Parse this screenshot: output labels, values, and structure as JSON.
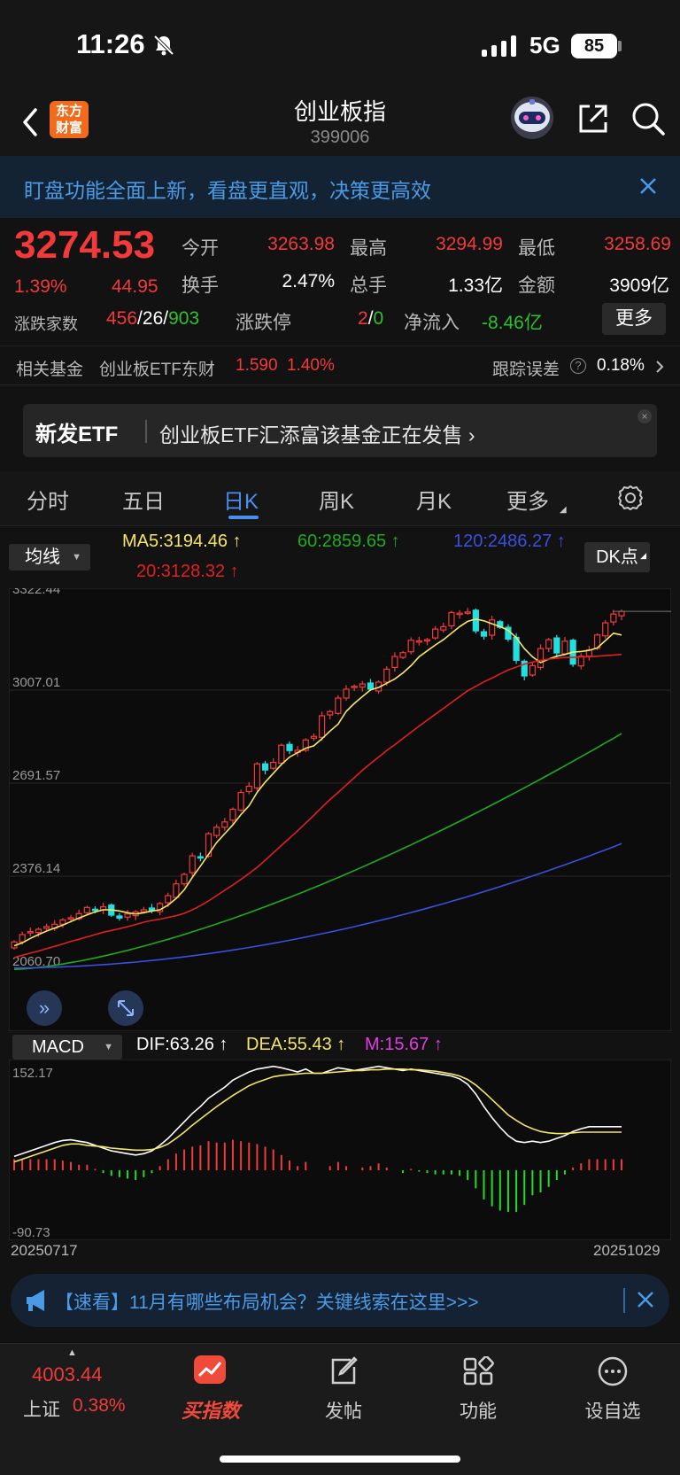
{
  "status_bar": {
    "time": "11:26",
    "network": "5G",
    "battery": "85"
  },
  "header": {
    "title": "创业板指",
    "code": "399006",
    "logo_line1": "东方",
    "logo_line2": "财富"
  },
  "banner": {
    "text": "盯盘功能全面上新，看盘更直观，决策更高效"
  },
  "quote": {
    "price": "3274.53",
    "change_pct": "1.39%",
    "change": "44.95",
    "open_label": "今开",
    "open": "3263.98",
    "high_label": "最高",
    "high": "3294.99",
    "low_label": "最低",
    "low": "3258.69",
    "turnover_label": "换手",
    "turnover": "2.47%",
    "volume_label": "总手",
    "volume": "1.33亿",
    "amount_label": "金额",
    "amount": "3909亿",
    "breadth_label": "涨跌家数",
    "up_count": "456",
    "flat_count": "26",
    "down_count": "903",
    "slash": "/",
    "limit_label": "涨跌停",
    "limit_up": "2",
    "limit_down": "0",
    "netflow_label": "净流入",
    "netflow": "-8.46亿",
    "more": "更多"
  },
  "related_fund": {
    "label": "相关基金",
    "name": "创业板ETF东财",
    "price": "1.590",
    "pct": "1.40%",
    "tracking_label": "跟踪误差",
    "tracking_value": "0.18%",
    "help": "?"
  },
  "new_etf": {
    "tag": "新发ETF",
    "text": "创业板ETF汇添富该基金正在发售 ›",
    "close": "×"
  },
  "tabs": [
    "分时",
    "五日",
    "日K",
    "周K",
    "月K",
    "更多"
  ],
  "ma_row": {
    "button": "均线",
    "ma5": "MA5:3194.46 ↑",
    "ma20": "20:3128.32 ↑",
    "ma60": "60:2859.65 ↑",
    "ma120": "120:2486.27 ↑",
    "dk": "DK点"
  },
  "macd_row": {
    "button": "MACD",
    "dif": "DIF:63.26 ↑",
    "dea": "DEA:55.43 ↑",
    "m": "M:15.67 ↑"
  },
  "colors": {
    "up": "#f23a3a",
    "down": "#22e0e0",
    "ma5": "#f5e663",
    "ma20": "#e02020",
    "ma60": "#1faa1f",
    "ma120": "#3b4fe0",
    "accent": "#4a8ef0"
  },
  "chart_data": [
    {
      "type": "candlestick",
      "title": "",
      "y_ticks": [
        "3322.44",
        "3007.01",
        "2691.57",
        "2376.14",
        "2060.70"
      ],
      "ylim": [
        2060.7,
        3322.44
      ],
      "x_start": "20250717",
      "x_end": "20251029",
      "close": [
        2153,
        2178,
        2188,
        2196,
        2205,
        2213,
        2228,
        2235,
        2249,
        2270,
        2262,
        2272,
        2244,
        2234,
        2248,
        2255,
        2262,
        2259,
        2283,
        2310,
        2350,
        2382,
        2445,
        2441,
        2520,
        2542,
        2560,
        2603,
        2660,
        2681,
        2757,
        2736,
        2762,
        2820,
        2802,
        2803,
        2838,
        2850,
        2920,
        2934,
        2980,
        3010,
        3020,
        3028,
        3010,
        3034,
        3078,
        3121,
        3134,
        3176,
        3174,
        3178,
        3214,
        3222,
        3270,
        3268,
        3272,
        3208,
        3190,
        3245,
        3220,
        3180,
        3108,
        3055,
        3090,
        3148,
        3178,
        3133,
        3173,
        3095,
        3122,
        3143,
        3194,
        3235,
        3265,
        3274
      ],
      "series": [
        {
          "name": "MA5",
          "values": [
            2140,
            2150,
            2165,
            2178,
            2190,
            2200,
            2210,
            2222,
            2234,
            2245,
            2255,
            2262,
            2262,
            2258,
            2252,
            2248,
            2252,
            2258,
            2262,
            2278,
            2300,
            2330,
            2372,
            2410,
            2450,
            2490,
            2520,
            2550,
            2585,
            2615,
            2660,
            2695,
            2725,
            2755,
            2780,
            2795,
            2810,
            2818,
            2842,
            2868,
            2892,
            2935,
            2962,
            2985,
            3008,
            3016,
            3030,
            3045,
            3065,
            3090,
            3120,
            3140,
            3160,
            3178,
            3200,
            3222,
            3240,
            3248,
            3242,
            3232,
            3222,
            3210,
            3185,
            3148,
            3120,
            3100,
            3112,
            3122,
            3128,
            3136,
            3138,
            3142,
            3150,
            3175,
            3200,
            3194
          ]
        },
        {
          "name": "20",
          "values": [
            2100,
            2108,
            2115,
            2122,
            2130,
            2138,
            2146,
            2155,
            2162,
            2170,
            2178,
            2186,
            2192,
            2198,
            2205,
            2212,
            2220,
            2226,
            2230,
            2236,
            2242,
            2250,
            2262,
            2276,
            2292,
            2310,
            2328,
            2346,
            2365,
            2385,
            2406,
            2430,
            2455,
            2480,
            2505,
            2530,
            2556,
            2582,
            2610,
            2636,
            2660,
            2685,
            2710,
            2735,
            2758,
            2780,
            2802,
            2822,
            2843,
            2864,
            2885,
            2905,
            2925,
            2945,
            2965,
            2985,
            3005,
            3020,
            3035,
            3048,
            3062,
            3075,
            3085,
            3095,
            3102,
            3108,
            3112,
            3115,
            3118,
            3118,
            3120,
            3120,
            3122,
            3124,
            3126,
            3128
          ]
        }
      ]
    },
    {
      "type": "bar",
      "title": "MACD",
      "y_ticks": [
        "152.17",
        "-90.73"
      ],
      "ylim": [
        -90.73,
        152.17
      ],
      "series": [
        {
          "name": "DIF",
          "values": [
            20,
            24,
            28,
            32,
            36,
            40,
            43,
            44,
            42,
            40,
            36,
            32,
            28,
            26,
            24,
            22,
            24,
            28,
            36,
            46,
            58,
            70,
            82,
            92,
            104,
            112,
            120,
            130,
            136,
            142,
            146,
            148,
            150,
            148,
            145,
            142,
            146,
            140,
            140,
            144,
            148,
            146,
            144,
            146,
            148,
            150,
            148,
            146,
            144,
            146,
            144,
            142,
            140,
            138,
            136,
            132,
            124,
            110,
            92,
            76,
            62,
            50,
            42,
            40,
            42,
            40,
            42,
            46,
            50,
            56,
            60,
            63,
            63,
            63,
            63,
            63
          ]
        },
        {
          "name": "DEA",
          "values": [
            12,
            16,
            20,
            24,
            28,
            32,
            36,
            38,
            38,
            36,
            35,
            34,
            32,
            31,
            30,
            29,
            29,
            30,
            33,
            38,
            46,
            55,
            65,
            74,
            83,
            92,
            100,
            108,
            115,
            122,
            127,
            131,
            135,
            137,
            138,
            139,
            140,
            140,
            140,
            141,
            142,
            143,
            144,
            144,
            145,
            145,
            146,
            146,
            146,
            145,
            145,
            144,
            143,
            141,
            139,
            136,
            131,
            123,
            113,
            102,
            91,
            80,
            72,
            65,
            60,
            56,
            54,
            53,
            53,
            54,
            55,
            55,
            55,
            55,
            55,
            55
          ]
        }
      ]
    }
  ],
  "ad": {
    "text": "【速看】11月有哪些布局机会？关键线索在这里>>>"
  },
  "bottom_nav": {
    "index_value": "4003.44",
    "index_name": "上证",
    "index_pct": "0.38%",
    "buy_index": "买指数",
    "post": "发帖",
    "functions": "功能",
    "watchlist": "设自选"
  }
}
